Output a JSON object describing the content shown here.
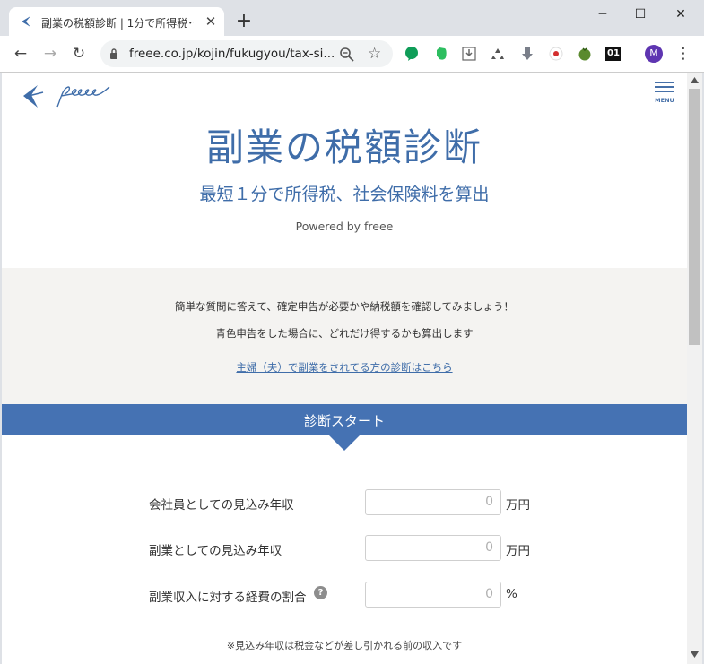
{
  "browser": {
    "tab_title": "副業の税額診断 | 1分で所得税･住",
    "tab_close": "✕",
    "new_tab": "+",
    "url": "freee.co.jp/kojin/fukugyou/tax-si...",
    "minimize": "─",
    "maximize": "☐",
    "close": "✕",
    "back": "←",
    "forward": "→",
    "reload": "↻",
    "star": "☆",
    "profile_initial": "M",
    "ext_01": "01",
    "kebab": "⋮"
  },
  "header": {
    "menu_label": "MENU"
  },
  "hero": {
    "title": "副業の税額診断",
    "subtitle": "最短１分で所得税、社会保険料を算出",
    "powered": "Powered by freee"
  },
  "intro": {
    "line1": "簡単な質問に答えて、確定申告が必要かや納税額を確認してみましょう！",
    "line2": "青色申告をした場合に、どれだけ得するかも算出します",
    "link": "主婦（夫）で副業をされてる方の診断はこちら"
  },
  "start": {
    "label": "診断スタート"
  },
  "form": {
    "rows": [
      {
        "label": "会社員としての見込み年収",
        "value": "0",
        "unit": "万円"
      },
      {
        "label": "副業としての見込み年収",
        "value": "0",
        "unit": "万円"
      },
      {
        "label": "副業収入に対する経費の割合",
        "value": "0",
        "unit": "%"
      }
    ],
    "help": "?",
    "note": "※見込み年収は税金などが差し引かれる前の収入です"
  },
  "colors": {
    "brand": "#4572b3",
    "heading": "#3f6da9"
  }
}
